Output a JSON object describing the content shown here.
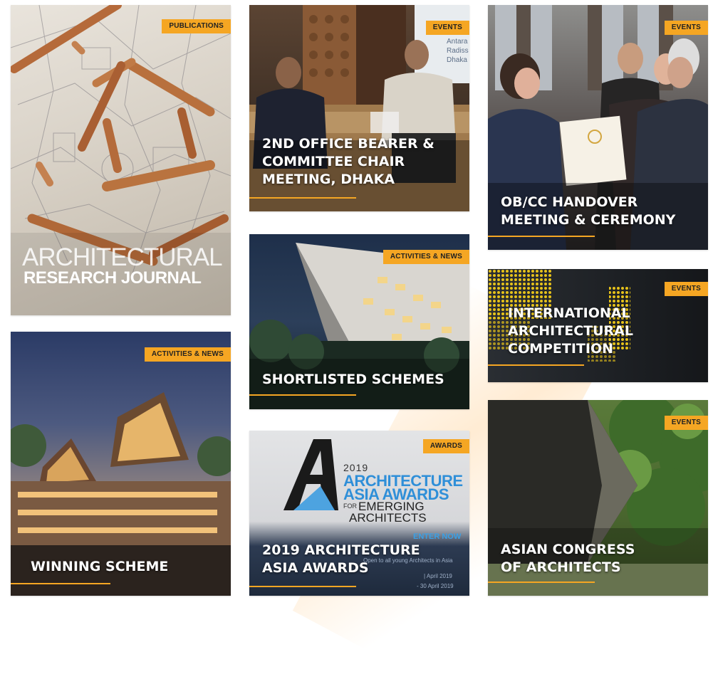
{
  "cards": {
    "arj": {
      "badge": "PUBLICATIONS",
      "title_top": "ARCHITECTURAL",
      "title_bottom": "RESEARCH JOURNAL"
    },
    "office_bearer": {
      "badge": "EVENTS",
      "title": "2ND OFFICE BEARER &\nCOMMITTEE CHAIR\nMEETING, DHAKA",
      "bg_sign": "Antara\nRadiss\nDhaka"
    },
    "handover": {
      "badge": "EVENTS",
      "title": "OB/CC HANDOVER\nMEETING & CEREMONY"
    },
    "shortlisted": {
      "badge": "ACTIVITIES & NEWS",
      "title": "SHORTLISTED SCHEMES"
    },
    "intl_comp": {
      "badge": "EVENTS",
      "title": "INTERNATIONAL\nARCHITECTURAL\nCOMPETITION"
    },
    "winning": {
      "badge": "ACTIVITIES & NEWS",
      "title": "WINNING SCHEME"
    },
    "awards": {
      "badge": "AWARDS",
      "title": "2019 ARCHITECTURE\nASIA AWARDS",
      "poster_year": "2019",
      "poster_line1": "ARCHITECTURE",
      "poster_line2": "ASIA AWARDS",
      "poster_for": "FOR",
      "poster_line3": "EMERGING",
      "poster_line4": "ARCHITECTS",
      "poster_cta": "ENTER NOW",
      "poster_small": "Open to all young Architects in Asia",
      "poster_date1": "| April 2019",
      "poster_date2": "- 30 April 2019"
    },
    "congress": {
      "badge": "EVENTS",
      "title": "ASIAN CONGRESS\nOF ARCHITECTS"
    }
  },
  "colors": {
    "accent": "#f5a623",
    "poster_blue": "#2f8fd8"
  }
}
